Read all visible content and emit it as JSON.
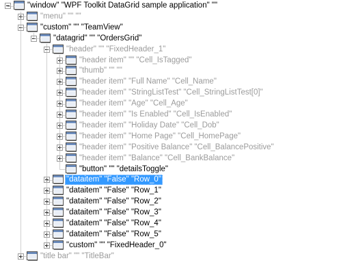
{
  "tree": [
    {
      "id": "window",
      "depth": 0,
      "expander": "expanded",
      "text": "\"window\" \"WPF Toolkit DataGrid sample application\" \"\"",
      "grey": false,
      "selected": false
    },
    {
      "id": "menu",
      "depth": 1,
      "expander": "collapsed",
      "text": "\"menu\" \"\" \"\"",
      "grey": true,
      "selected": false
    },
    {
      "id": "custom-teamview",
      "depth": 1,
      "expander": "expanded",
      "text": "\"custom\" \"\" \"TeamView\"",
      "grey": false,
      "selected": false
    },
    {
      "id": "datagrid",
      "depth": 2,
      "expander": "expanded",
      "text": "\"datagrid\" \"\" \"OrdersGrid\"",
      "grey": false,
      "selected": false
    },
    {
      "id": "header-fixedheader",
      "depth": 3,
      "expander": "expanded",
      "text": "\"header\" \"\" \"FixedHeader_1\"",
      "grey": true,
      "selected": false
    },
    {
      "id": "header-item-cell-istagged",
      "depth": 4,
      "expander": "collapsed",
      "text": "\"header item\" \"\" \"Cell_IsTagged\"",
      "grey": true,
      "selected": false
    },
    {
      "id": "thumb",
      "depth": 4,
      "expander": "collapsed",
      "text": "\"thumb\" \"\" \"\"",
      "grey": true,
      "selected": false
    },
    {
      "id": "header-item-full-name",
      "depth": 4,
      "expander": "collapsed",
      "text": "\"header item\" \"Full Name\" \"Cell_Name\"",
      "grey": true,
      "selected": false
    },
    {
      "id": "header-item-stringlisttest",
      "depth": 4,
      "expander": "collapsed",
      "text": "\"header item\" \"StringListTest\" \"Cell_StringListTest[0]\"",
      "grey": true,
      "selected": false
    },
    {
      "id": "header-item-age",
      "depth": 4,
      "expander": "collapsed",
      "text": "\"header item\" \"Age\" \"Cell_Age\"",
      "grey": true,
      "selected": false
    },
    {
      "id": "header-item-is-enabled",
      "depth": 4,
      "expander": "collapsed",
      "text": "\"header item\" \"Is Enabled\" \"Cell_IsEnabled\"",
      "grey": true,
      "selected": false
    },
    {
      "id": "header-item-holiday-date",
      "depth": 4,
      "expander": "collapsed",
      "text": "\"header item\" \"Holiday Date\" \"Cell_Dob\"",
      "grey": true,
      "selected": false
    },
    {
      "id": "header-item-home-page",
      "depth": 4,
      "expander": "collapsed",
      "text": "\"header item\" \"Home Page\" \"Cell_HomePage\"",
      "grey": true,
      "selected": false
    },
    {
      "id": "header-item-positive-balance",
      "depth": 4,
      "expander": "collapsed",
      "text": "\"header item\" \"Positive Balance\" \"Cell_BalancePositive\"",
      "grey": true,
      "selected": false
    },
    {
      "id": "header-item-balance",
      "depth": 4,
      "expander": "collapsed",
      "text": "\"header item\" \"Balance\" \"Cell_BankBalance\"",
      "grey": true,
      "selected": false
    },
    {
      "id": "button-detailstoggle",
      "depth": 4,
      "expander": "none",
      "text": "\"button\" \"\" \"detailsToggle\"",
      "grey": false,
      "selected": false
    },
    {
      "id": "dataitem-row-0",
      "depth": 3,
      "expander": "collapsed",
      "text": "\"dataitem\" \"False\" \"Row_0\"",
      "grey": false,
      "selected": true
    },
    {
      "id": "dataitem-row-1",
      "depth": 3,
      "expander": "collapsed",
      "text": "\"dataitem\" \"False\" \"Row_1\"",
      "grey": false,
      "selected": false
    },
    {
      "id": "dataitem-row-2",
      "depth": 3,
      "expander": "collapsed",
      "text": "\"dataitem\" \"False\" \"Row_2\"",
      "grey": false,
      "selected": false
    },
    {
      "id": "dataitem-row-3",
      "depth": 3,
      "expander": "collapsed",
      "text": "\"dataitem\" \"False\" \"Row_3\"",
      "grey": false,
      "selected": false
    },
    {
      "id": "dataitem-row-4",
      "depth": 3,
      "expander": "collapsed",
      "text": "\"dataitem\" \"False\" \"Row_4\"",
      "grey": false,
      "selected": false
    },
    {
      "id": "dataitem-row-5",
      "depth": 3,
      "expander": "collapsed",
      "text": "\"dataitem\" \"False\" \"Row_5\"",
      "grey": false,
      "selected": false
    },
    {
      "id": "custom-fixedheader-0",
      "depth": 3,
      "expander": "collapsed",
      "text": "\"custom\" \"\" \"FixedHeader_0\"",
      "grey": false,
      "selected": false
    },
    {
      "id": "title-bar",
      "depth": 1,
      "expander": "collapsed",
      "text": "\"title bar\" \"\" \"TitleBar\"",
      "grey": true,
      "selected": false
    }
  ],
  "colors": {
    "selection_bg": "#3399ff",
    "selection_text": "#ffffff",
    "grey_text": "#9b9b9b",
    "tree_lines": "#a0a0a0"
  },
  "icons": {
    "node": "window-node-icon"
  }
}
